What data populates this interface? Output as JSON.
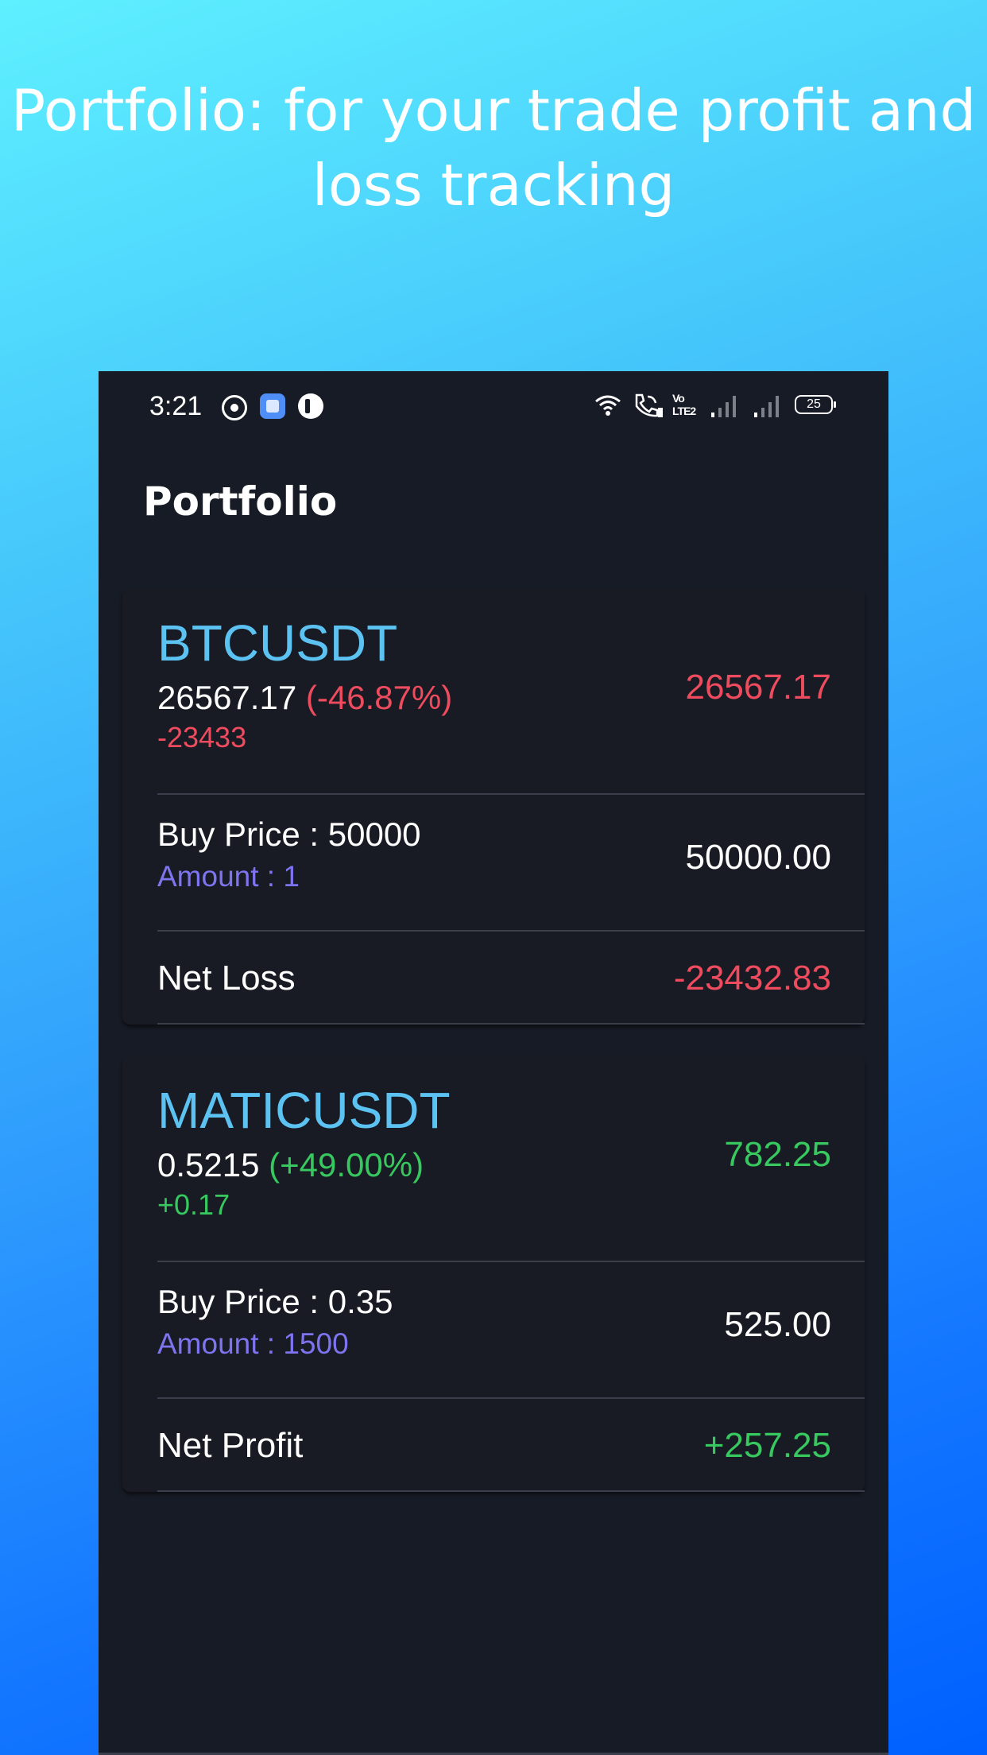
{
  "promo": {
    "title": "Portfolio: for your trade profit and loss tracking"
  },
  "status_bar": {
    "time": "3:21",
    "battery": "25",
    "volte_label": "Vo LTE2",
    "icons": [
      "whatsapp-icon",
      "app-icon",
      "circle-icon",
      "wifi-icon",
      "wifi-call-icon",
      "volte-icon",
      "signal-icon",
      "signal-icon",
      "battery-icon"
    ]
  },
  "page": {
    "title": "Portfolio"
  },
  "holdings": [
    {
      "symbol": "BTCUSDT",
      "current_price": "26567.17",
      "change_percent": "(-46.87%)",
      "change_amount": "-23433",
      "market_value": "26567.17",
      "buy_price_label": "Buy Price : 50000",
      "amount_label": "Amount : 1",
      "cost_value": "50000.00",
      "net_label": "Net Loss",
      "net_value": "-23432.83",
      "direction": "loss"
    },
    {
      "symbol": "MATICUSDT",
      "current_price": "0.5215",
      "change_percent": "(+49.00%)",
      "change_amount": "+0.17",
      "market_value": "782.25",
      "buy_price_label": "Buy Price : 0.35",
      "amount_label": "Amount : 1500",
      "cost_value": "525.00",
      "net_label": "Net Profit",
      "net_value": "+257.25",
      "direction": "gain"
    }
  ],
  "colors": {
    "background_top": "#5ef0ff",
    "background_bottom": "#0060ff",
    "screen": "#171b25",
    "symbol": "#5cc2f2",
    "loss": "#ee4c5e",
    "gain": "#37c95f",
    "amount": "#7e74f0"
  }
}
